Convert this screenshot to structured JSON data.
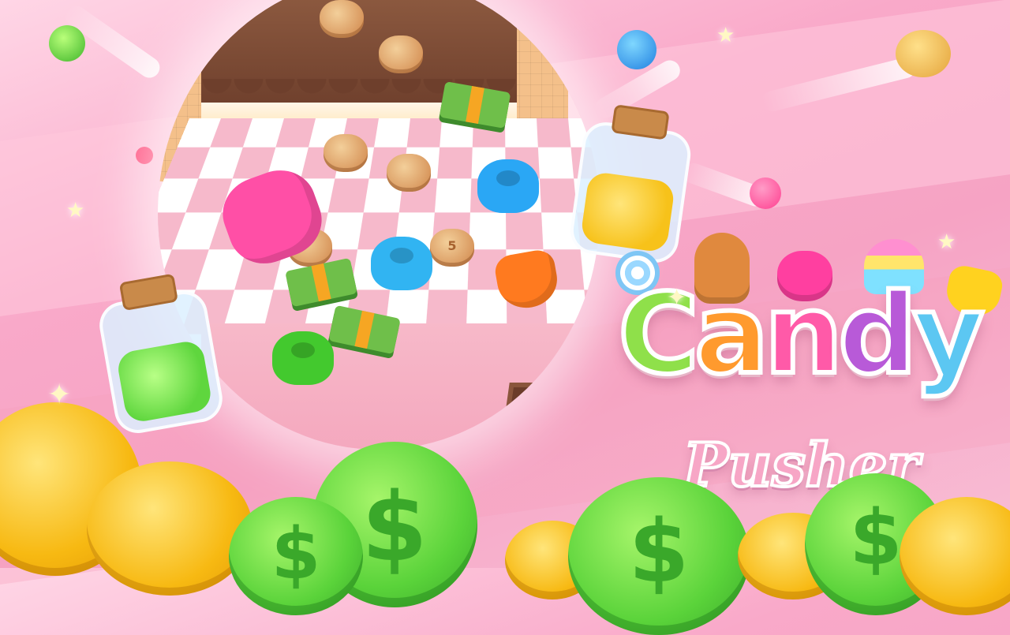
{
  "game": {
    "title_letters": [
      "C",
      "a",
      "n",
      "d",
      "y"
    ],
    "title_colors": [
      "#8fe04a",
      "#ff9a2e",
      "#ff5aa8",
      "#b85ad8",
      "#5cc7f2"
    ],
    "subtitle": "Pusher",
    "cookie_number": "5"
  },
  "board": {
    "cake_color": "#7b4a35",
    "checker_colors": [
      "#ffffff",
      "#f6b9cb"
    ],
    "candies": [
      {
        "kind": "cookie"
      },
      {
        "kind": "cookie"
      },
      {
        "kind": "cookie"
      },
      {
        "kind": "cookie"
      },
      {
        "kind": "cookie"
      },
      {
        "kind": "cookie"
      },
      {
        "kind": "cookie-numbered"
      },
      {
        "kind": "jelly",
        "color": "#2aa7f5"
      },
      {
        "kind": "jelly",
        "color": "#31b4f2"
      },
      {
        "kind": "jelly",
        "color": "#43c92e"
      },
      {
        "kind": "gummy-bear",
        "color": "#ff4fa6"
      },
      {
        "kind": "heart",
        "color": "#ff7a1f"
      },
      {
        "kind": "cash-stack"
      },
      {
        "kind": "cash-stack"
      },
      {
        "kind": "cash-stack"
      }
    ]
  },
  "jars": [
    {
      "name": "gold-coin-jar",
      "fill": "#f7c21a"
    },
    {
      "name": "green-coin-jar",
      "fill": "#5fd63e"
    }
  ],
  "coins": {
    "gold_color": "#f7b912",
    "green_color": "#5ad33a",
    "green_symbol": "$"
  },
  "background": {
    "colors": [
      "#ffd6e6",
      "#f9a9c9",
      "#f8bfd6"
    ]
  }
}
